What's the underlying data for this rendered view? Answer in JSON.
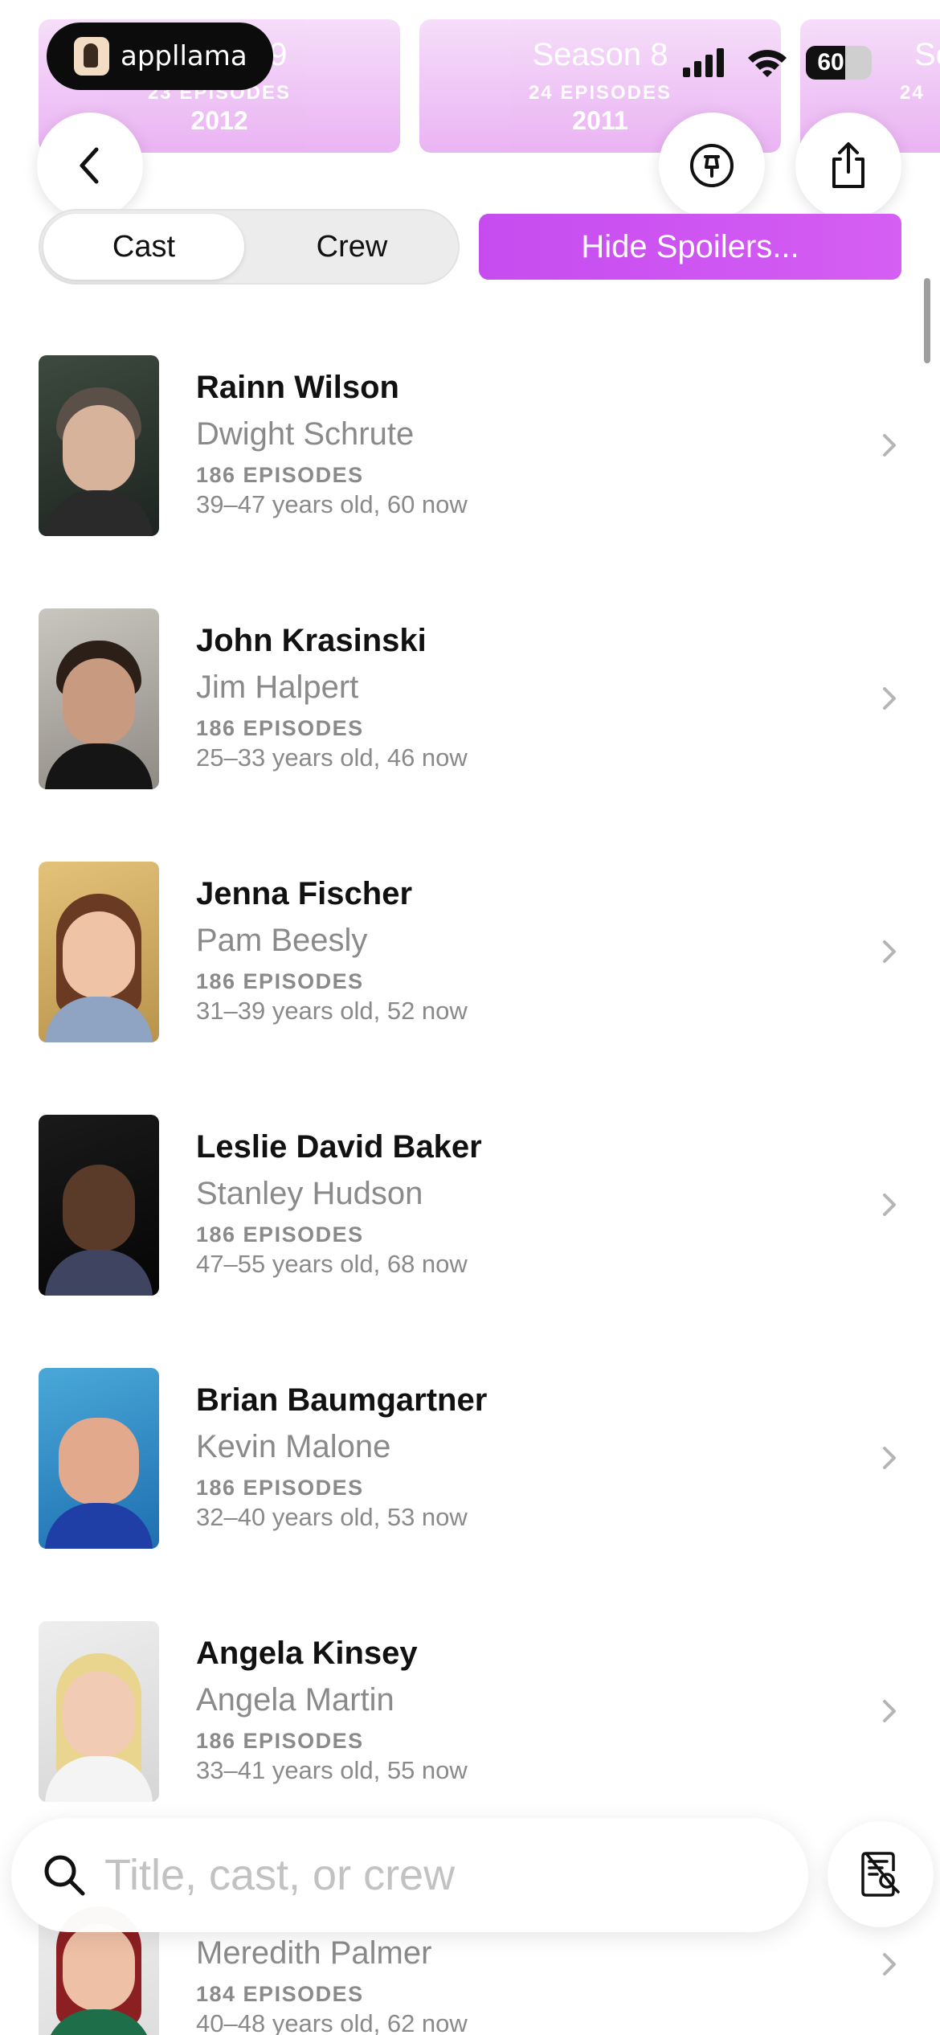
{
  "seasons": [
    {
      "title": "Season 9",
      "episodes": "23 EPISODES",
      "year": "2012"
    },
    {
      "title": "Season 8",
      "episodes": "24 EPISODES",
      "year": "2011"
    },
    {
      "title": "Se",
      "episodes": "24",
      "year": ""
    }
  ],
  "brand": {
    "name": "appllama"
  },
  "status_bar": {
    "battery": "60"
  },
  "tabs": {
    "cast": "Cast",
    "crew": "Crew",
    "active": "Cast"
  },
  "spoilers_button": "Hide Spoilers...",
  "cast": [
    {
      "name": "Rainn Wilson",
      "role": "Dwight Schrute",
      "episodes": "186 EPISODES",
      "ages": "39–47 years old, 60 now"
    },
    {
      "name": "John Krasinski",
      "role": "Jim Halpert",
      "episodes": "186 EPISODES",
      "ages": "25–33 years old, 46 now"
    },
    {
      "name": "Jenna Fischer",
      "role": "Pam Beesly",
      "episodes": "186 EPISODES",
      "ages": "31–39 years old, 52 now"
    },
    {
      "name": "Leslie David Baker",
      "role": "Stanley Hudson",
      "episodes": "186 EPISODES",
      "ages": "47–55 years old, 68 now"
    },
    {
      "name": "Brian Baumgartner",
      "role": "Kevin Malone",
      "episodes": "186 EPISODES",
      "ages": "32–40 years old, 53 now"
    },
    {
      "name": "Angela Kinsey",
      "role": "Angela Martin",
      "episodes": "186 EPISODES",
      "ages": "33–41 years old, 55 now"
    },
    {
      "name": "",
      "role": "Meredith Palmer",
      "episodes": "184 EPISODES",
      "ages": "40–48 years old, 62 now"
    }
  ],
  "search": {
    "placeholder": "Title, cast, or crew",
    "value": ""
  },
  "icons": {
    "back": "chevron-left-icon",
    "pin": "pin-icon",
    "share": "share-icon",
    "search": "magnifying-glass-icon",
    "doc_search": "document-search-icon",
    "row_chevron": "chevron-right-icon"
  },
  "colors": {
    "accent": "#d055f2",
    "season_card": "#e9aef3",
    "secondary_text": "#8a8a8a"
  }
}
